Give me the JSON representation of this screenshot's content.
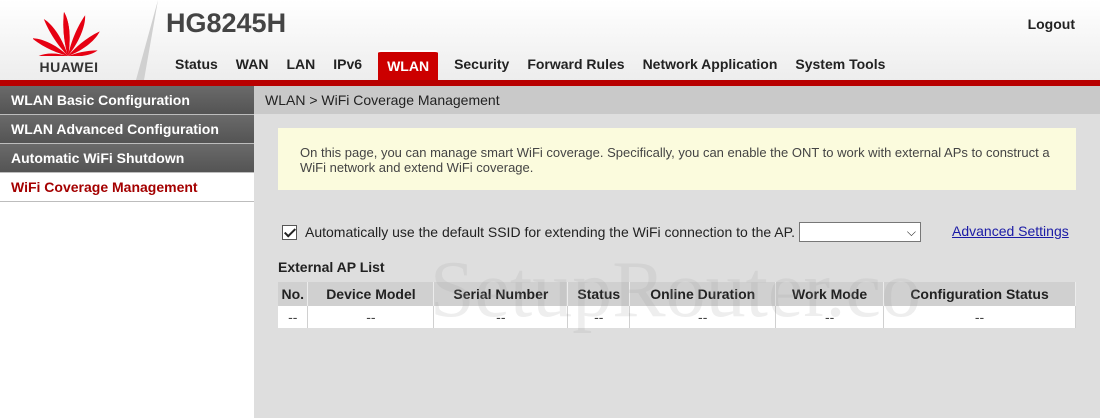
{
  "brand": {
    "logo_text": "HUAWEI",
    "accent": "#cc0000"
  },
  "header": {
    "product": "HG8245H",
    "logout": "Logout"
  },
  "nav": [
    "Status",
    "WAN",
    "LAN",
    "IPv6",
    "WLAN",
    "Security",
    "Forward Rules",
    "Network Application",
    "System Tools"
  ],
  "nav_active": "WLAN",
  "sidebar": {
    "items": [
      {
        "label": "WLAN Basic Configuration"
      },
      {
        "label": "WLAN Advanced Configuration"
      },
      {
        "label": "Automatic WiFi Shutdown"
      },
      {
        "label": "WiFi Coverage Management"
      }
    ],
    "active": "WiFi Coverage Management"
  },
  "main": {
    "breadcrumb": "WLAN > WiFi Coverage Management",
    "info": "On this page, you can manage smart WiFi coverage. Specifically, you can enable the ONT to work with external APs to construct a WiFi network and extend WiFi coverage.",
    "auto_ssid_label": "Automatically use the default SSID for extending the WiFi connection to the AP.",
    "auto_ssid_checked": true,
    "ssid_select_value": "",
    "advanced_link": "Advanced Settings",
    "list_title": "External AP List",
    "table": {
      "headers": [
        "No.",
        "Device Model",
        "Serial Number",
        "Status",
        "Online Duration",
        "Work Mode",
        "Configuration Status"
      ],
      "rows": [
        [
          "--",
          "--",
          "--",
          "--",
          "--",
          "--",
          "--"
        ]
      ]
    }
  },
  "watermark": "SetupRouter.co"
}
